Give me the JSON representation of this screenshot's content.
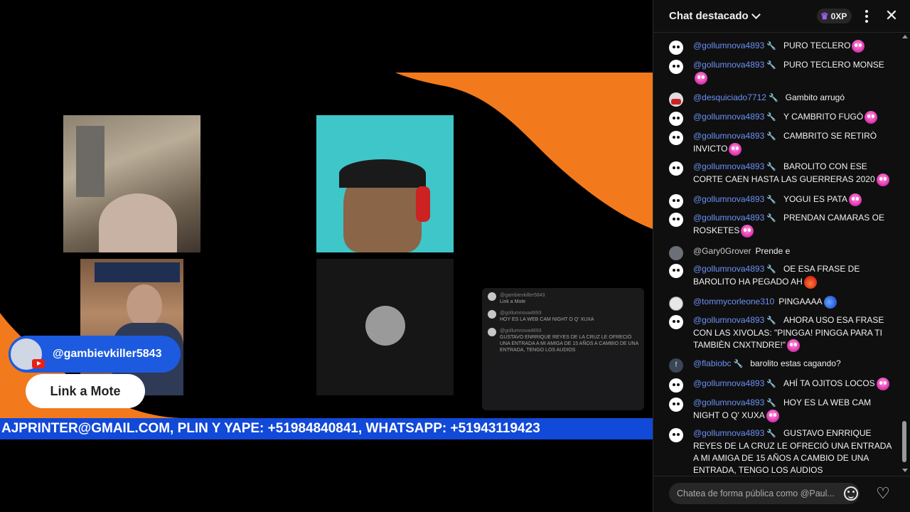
{
  "stream": {
    "ticker": "AJPRINTER@GMAIL.COM, PLIN Y YAPE: +51984840841, WHATSAPP: +51943119423",
    "host_handle": "@gambievkiller5843",
    "link_button": "Link a Mote",
    "mini_chat": [
      {
        "name": "@gambievkiller5843",
        "text": "Link a Mote"
      },
      {
        "name": "@gollumnova4893",
        "text": "HOY ES LA WEB CAM NIGHT O Q' XUXA"
      },
      {
        "name": "@gollumnova4893",
        "text": "GUSTAVO ENRRIQUE REYES DE LA CRUZ LE OFRECIÓ UNA ENTRADA A MI AMIGA DE 15 AÑOS A CAMBIO DE UNA ENTRADA, TENGO LOS AUDIOS"
      }
    ]
  },
  "chat": {
    "title": "Chat destacado",
    "xp": "0XP",
    "input_placeholder": "Chatea de forma pública como @Paul...",
    "messages": [
      {
        "author": "@gollumnova4893",
        "text": "PURO TECLERO",
        "avatar": "skull",
        "mod": true,
        "emoji": "pink"
      },
      {
        "author": "@gollumnova4893",
        "text": "PURO TECLERO MONSE",
        "avatar": "skull",
        "mod": true,
        "emoji": "pink"
      },
      {
        "author": "@desquiciado7712",
        "text": "Gambito arrugó",
        "avatar": "red",
        "mod": true
      },
      {
        "author": "@gollumnova4893",
        "text": "Y CAMBRITO FUGÒ",
        "avatar": "skull",
        "mod": true,
        "emoji": "pink"
      },
      {
        "author": "@gollumnova4893",
        "text": "CAMBRITO SE RETIRÒ INVICTO",
        "avatar": "skull",
        "mod": true,
        "emoji": "pink"
      },
      {
        "author": "@gollumnova4893",
        "text": "BAROLITO CON ESE CORTE CAEN HASTA LAS GUERRERAS 2020",
        "avatar": "skull",
        "mod": true,
        "emoji": "pink"
      },
      {
        "author": "@gollumnova4893",
        "text": "YOGUI ES PATA",
        "avatar": "skull",
        "mod": true,
        "emoji": "pink"
      },
      {
        "author": "@gollumnova4893",
        "text": "PRENDAN CAMARAS OE ROSKETES",
        "avatar": "skull",
        "mod": true,
        "emoji": "pink"
      },
      {
        "author": "@Gary0Grover",
        "text": "Prende e",
        "avatar": "gary",
        "mod": false
      },
      {
        "author": "@gollumnova4893",
        "text": "OE ESA FRASE DE BAROLITO HA PEGADO AH",
        "avatar": "skull",
        "mod": true,
        "emoji": "fire"
      },
      {
        "author": "@tommycorleone310",
        "text": "PINGAAAA",
        "avatar": "tommy",
        "mod": false,
        "emoji": "blue"
      },
      {
        "author": "@gollumnova4893",
        "text": "AHORA USO ESA FRASE CON LAS XIVOLAS: \"PINGGA! PINGGA PARA TI TAMBIÈN CNXTNDRE!\"",
        "avatar": "skull",
        "mod": true,
        "emoji": "pink"
      },
      {
        "author": "@flabiobc",
        "text": "barolito estas cagando?",
        "avatar": "f",
        "mod": true
      },
      {
        "author": "@gollumnova4893",
        "text": "AHÍ TA OJITOS LOCOS",
        "avatar": "skull",
        "mod": true,
        "emoji": "pink"
      },
      {
        "author": "@gollumnova4893",
        "text": "HOY ES LA WEB CAM NIGHT O Q' XUXA",
        "avatar": "skull",
        "mod": true,
        "emoji": "pink"
      },
      {
        "author": "@gollumnova4893",
        "text": "GUSTAVO ENRRIQUE REYES DE LA CRUZ LE OFRECIÓ UNA ENTRADA A MI AMIGA DE 15 AÑOS A CAMBIO DE UNA ENTRADA, TENGO LOS AUDIOS",
        "avatar": "skull",
        "mod": true
      }
    ]
  },
  "icons": {
    "crown": "crown-icon",
    "more": "more-vert-icon",
    "close": "close-icon",
    "emoji": "smile-icon",
    "heart": "heart-icon",
    "mod": "wrench-icon"
  },
  "colors": {
    "accent_orange": "#f07a1e",
    "ticker_blue": "#1149d8",
    "author_blue": "#6b91f5"
  }
}
